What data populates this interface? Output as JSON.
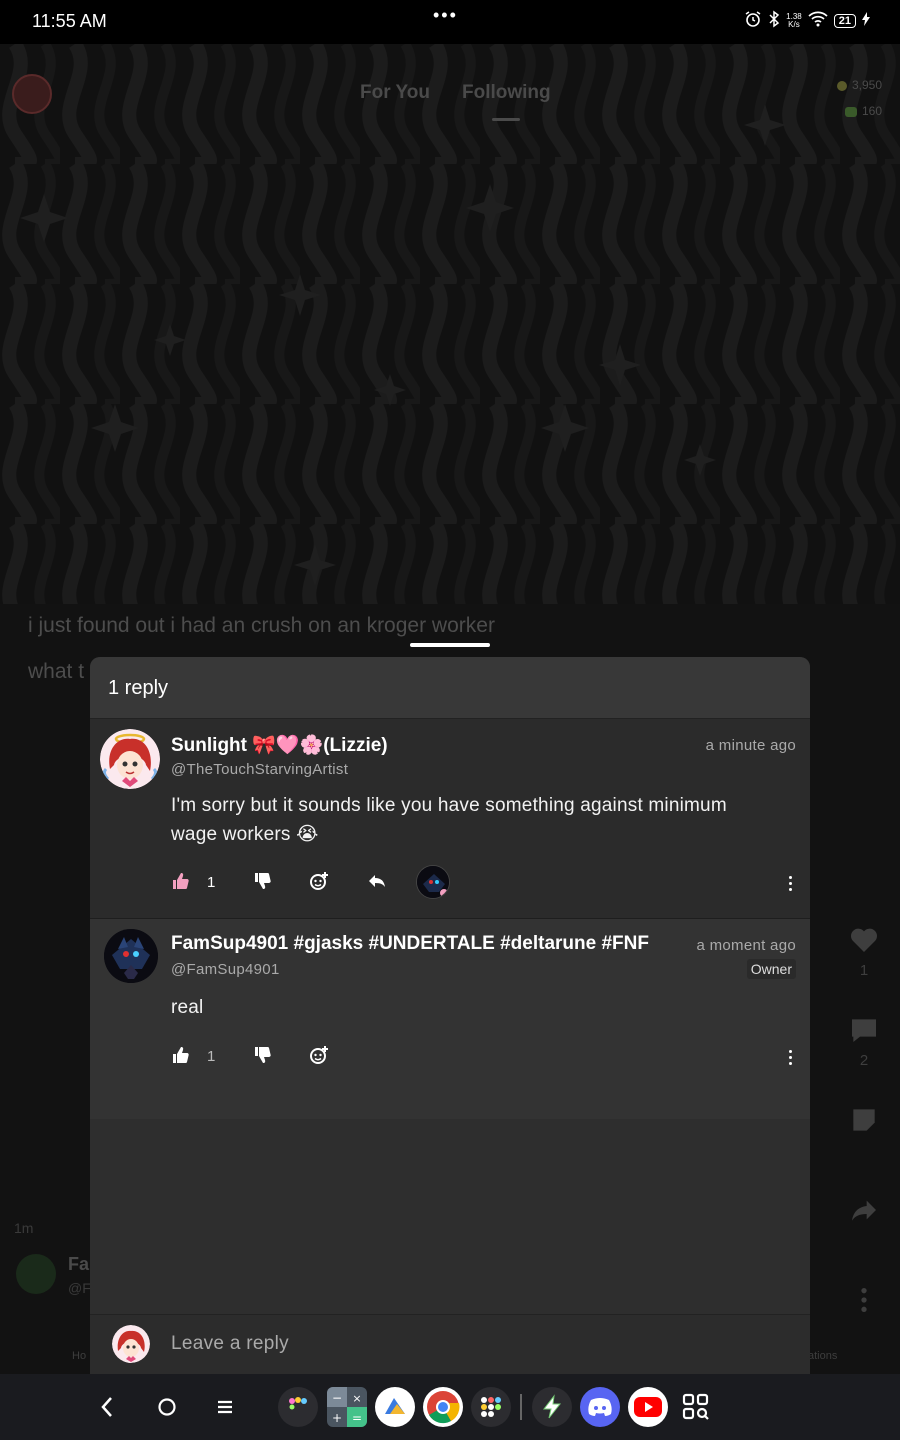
{
  "status_bar": {
    "time": "11:55 AM",
    "dots": "•••",
    "net_speed_value": "1.38",
    "net_speed_unit": "K/s",
    "battery": "21"
  },
  "feed": {
    "tabs": [
      "For You",
      "Following"
    ],
    "active_tab": "Following",
    "coins": "3,950",
    "gems": "160",
    "post_line1": "i just found out i had an crush on an kroger worker",
    "post_line2": "what t",
    "post_time": "1m",
    "author_name_partial": "Fa",
    "author_handle_partial": "@F",
    "likes": "1",
    "comments": "2",
    "bottom_tab_left_partial": "Ho",
    "bottom_tab_right_partial": "ations"
  },
  "sheet": {
    "header": "1 reply",
    "parent_comment": {
      "name": "Sunlight 🎀🩷🌸(Lizzie)",
      "handle": "@TheTouchStarvingArtist",
      "time": "a minute ago",
      "body": "I'm sorry but it sounds like you have something against minimum wage workers 😭",
      "likes": "1"
    },
    "reply_comment": {
      "name": "FamSup4901 #gjasks #UNDERTALE #deltarune #FNF",
      "handle": "@FamSup4901",
      "time": "a moment ago",
      "badge": "Owner",
      "body": "real",
      "likes": "1"
    },
    "reply_placeholder": "Leave a reply"
  },
  "colors": {
    "background": "#000000",
    "sheet": "#2e2e2e",
    "like_pink": "#f3a0c0",
    "discord": "#5865f2",
    "youtube": "#ff0000"
  },
  "dock_apps": [
    "folder-app",
    "calculator-app",
    "files-app",
    "chrome-app",
    "app-folder-2",
    "lightning-app",
    "discord-app",
    "youtube-app",
    "app-grid"
  ]
}
